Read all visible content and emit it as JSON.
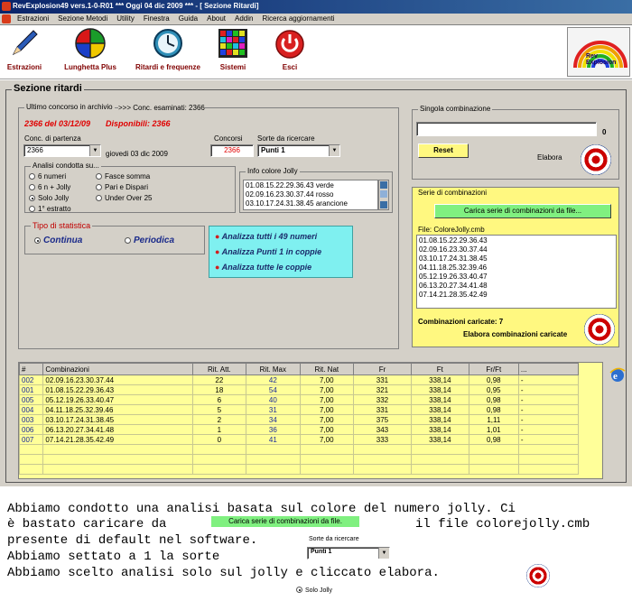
{
  "window": {
    "title": "RevExplosion49 vers.1-0-R01  ***  Oggi 04 dic 2009  ***  - [ Sezione Ritardi]"
  },
  "menu": [
    "Estrazioni",
    "Sezione Metodi",
    "Utility",
    "Finestra",
    "Guida",
    "About",
    "Addin",
    "Ricerca aggiornamenti"
  ],
  "toolbar": {
    "estrazioni": "Estrazioni",
    "lunghetta": "Lunghetta Plus",
    "ritardi": "Ritardi e frequenze",
    "sistemi": "Sistemi",
    "esci": "Esci",
    "logo_text": "Rev Explosion"
  },
  "section": {
    "title": "Sezione ritardi"
  },
  "archive": {
    "legend": "Ultimo concorso in archivio",
    "examined": ">>> Conc. esaminati: 2366",
    "last": "2366 del 03/12/09",
    "available": "Disponibili: 2366",
    "start_label": "Conc. di partenza",
    "start_value": "2366",
    "date": "giovedi 03 dic 2009",
    "concorsi_label": "Concorsi",
    "concorsi_value": "2366",
    "sorte_label": "Sorte da ricercare",
    "sorte_value": "Punti 1"
  },
  "analysis": {
    "legend": "Analisi condotta su...",
    "options": [
      "6 numeri",
      "6 n + Jolly",
      "Solo Jolly",
      "1° estratto",
      "Fasce somma",
      "Pari e Dispari",
      "Under Over 25"
    ],
    "selected": "Solo Jolly"
  },
  "jolly": {
    "legend": "Info colore Jolly",
    "items": [
      "01.08.15.22.29.36.43 verde",
      "02.09.16.23.30.37.44 rosso",
      "03.10.17.24.31.38.45 arancione"
    ]
  },
  "stat": {
    "legend": "Tipo di statistica",
    "continua": "Continua",
    "periodica": "Periodica"
  },
  "actions": [
    "Analizza tutti i 49 numeri",
    "Analizza Punti 1 in coppie",
    "Analizza tutte le coppie"
  ],
  "single": {
    "legend": "Singola combinazione",
    "count": "0",
    "reset": "Reset",
    "elabora": "Elabora"
  },
  "series": {
    "legend": "Serie di combinazioni",
    "load_btn": "Carica serie di combinazioni da file...",
    "file": "File: ColoreJolly.cmb",
    "items": [
      "01.08.15.22.29.36.43",
      "02.09.16.23.30.37.44",
      "03.10.17.24.31.38.45",
      "04.11.18.25.32.39.46",
      "05.12.19.26.33.40.47",
      "06.13.20.27.34.41.48",
      "07.14.21.28.35.42.49"
    ],
    "loaded": "Combinazioni caricate: 7",
    "elabora": "Elabora combinazioni caricate"
  },
  "table": {
    "headers": [
      "#",
      "Combinazioni",
      "Rit. Att.",
      "Rit. Max",
      "Rit. Nat",
      "Fr",
      "Ft",
      "Fr/Ft",
      "..."
    ],
    "rows": [
      [
        "002",
        "02.09.16.23.30.37.44",
        "22",
        "42",
        "7,00",
        "331",
        "338,14",
        "0,98",
        "-"
      ],
      [
        "001",
        "01.08.15.22.29.36.43",
        "18",
        "54",
        "7,00",
        "321",
        "338,14",
        "0,95",
        "-"
      ],
      [
        "005",
        "05.12.19.26.33.40.47",
        "6",
        "40",
        "7,00",
        "332",
        "338,14",
        "0,98",
        "-"
      ],
      [
        "004",
        "04.11.18.25.32.39.46",
        "5",
        "31",
        "7,00",
        "331",
        "338,14",
        "0,98",
        "-"
      ],
      [
        "003",
        "03.10.17.24.31.38.45",
        "2",
        "34",
        "7,00",
        "375",
        "338,14",
        "1,11",
        "-"
      ],
      [
        "006",
        "06.13.20.27.34.41.48",
        "1",
        "36",
        "7,00",
        "343",
        "338,14",
        "1,01",
        "-"
      ],
      [
        "007",
        "07.14.21.28.35.42.49",
        "0",
        "41",
        "7,00",
        "333",
        "338,14",
        "0,98",
        "-"
      ]
    ]
  },
  "notes": {
    "line1": "Abbiamo condotto una analisi basata sul colore del numero jolly. Ci",
    "line2a": "è bastato caricare da",
    "line2_btn": "Carica serie di combinazioni da file.",
    "line2b": "il file colorejolly.cmb",
    "line3": "presente di default nel software.",
    "line3_label": "Sorte da ricercare",
    "line4": "Abbiamo settato a 1 la sorte",
    "line4_combo": "Punti 1",
    "line5": "Abbiamo scelto analisi solo sul jolly e cliccato elabora.",
    "radio": "Solo Jolly"
  }
}
